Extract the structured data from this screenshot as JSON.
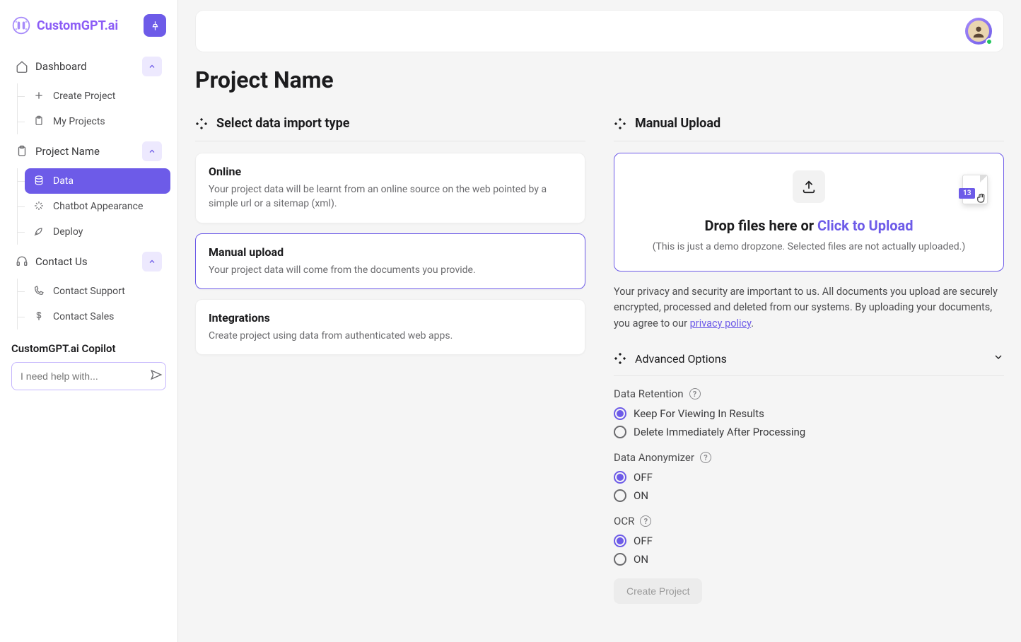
{
  "brand": {
    "name": "CustomGPT.ai"
  },
  "sidebar": {
    "dashboard": {
      "label": "Dashboard",
      "children": {
        "create": "Create Project",
        "my_projects": "My Projects"
      }
    },
    "project": {
      "label": "Project Name",
      "children": {
        "data": "Data",
        "appearance": "Chatbot Appearance",
        "deploy": "Deploy"
      }
    },
    "contact": {
      "label": "Contact Us",
      "children": {
        "support": "Contact Support",
        "sales": "Contact Sales"
      }
    },
    "copilot": {
      "title": "CustomGPT.ai Copilot",
      "placeholder": "I need help with..."
    }
  },
  "page": {
    "title": "Project Name"
  },
  "import": {
    "heading": "Select data import type",
    "online": {
      "title": "Online",
      "desc": "Your project data will be learnt from an online source on the web pointed by a simple url or a sitemap (xml)."
    },
    "manual": {
      "title": "Manual upload",
      "desc": "Your project data will come from the documents you provide."
    },
    "integrations": {
      "title": "Integrations",
      "desc": "Create project using data from authenticated web apps."
    }
  },
  "upload": {
    "heading": "Manual Upload",
    "drop_prefix": "Drop files here or ",
    "drop_link": "Click to Upload",
    "note": "(This is just a demo dropzone. Selected files are not actually uploaded.)",
    "file_badge": "13",
    "privacy_text_1": "Your privacy and security are important to us. All documents you upload are securely encrypted, processed and deleted from our systems. By uploading your documents, you agree to our ",
    "privacy_link_text": "privacy policy",
    "privacy_text_2": "."
  },
  "advanced": {
    "heading": "Advanced Options",
    "retention": {
      "label": "Data Retention",
      "keep": "Keep For Viewing In Results",
      "delete": "Delete Immediately After Processing",
      "selected": "keep"
    },
    "anonymizer": {
      "label": "Data Anonymizer",
      "off": "OFF",
      "on": "ON",
      "selected": "off"
    },
    "ocr": {
      "label": "OCR",
      "off": "OFF",
      "on": "ON",
      "selected": "off"
    },
    "create_button": "Create Project"
  },
  "colors": {
    "accent": "#6d5be8",
    "accent_light": "#ede9fe"
  }
}
